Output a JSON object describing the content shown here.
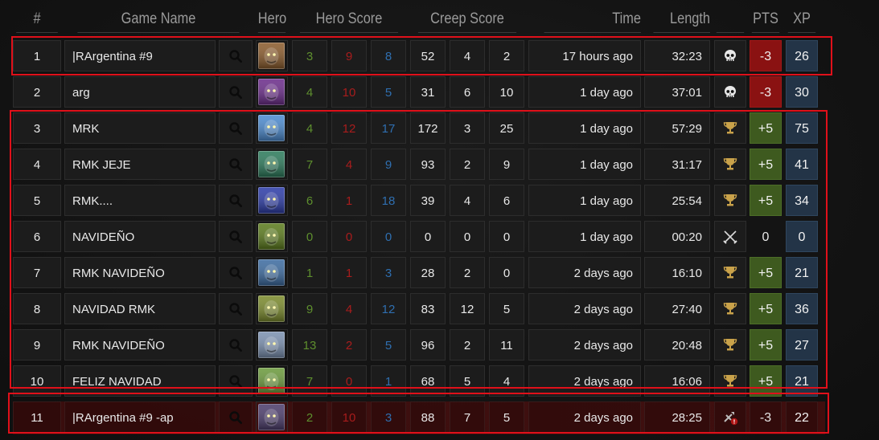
{
  "headers": {
    "rank": "#",
    "game_name": "Game Name",
    "hero": "Hero",
    "hero_score": "Hero Score",
    "creep_score": "Creep Score",
    "time": "Time",
    "length": "Length",
    "pts": "PTS",
    "xp": "XP"
  },
  "colors": {
    "kills": "#5e8f2e",
    "deaths": "#a81c1c",
    "assists": "#2f6fb0",
    "pts_positive": "#3e5a1f",
    "pts_negative": "#8a1212",
    "xp_bg": "#233447",
    "highlight_box": "#e0101a"
  },
  "rows": [
    {
      "rank": "1",
      "name": "|RArgentina #9",
      "hero": "beast-face-icon",
      "hero_color": "#8a5a2a",
      "k": "3",
      "d": "9",
      "a": "8",
      "c1": "52",
      "c2": "4",
      "c3": "2",
      "time": "17 hours ago",
      "length": "32:23",
      "result": "skull-icon",
      "pts": "-3",
      "pts_type": "neg",
      "xp": "26",
      "row_style": "normal"
    },
    {
      "rank": "2",
      "name": "arg",
      "hero": "purple-beast-icon",
      "hero_color": "#6a2a8a",
      "k": "4",
      "d": "10",
      "a": "5",
      "c1": "31",
      "c2": "6",
      "c3": "10",
      "time": "1 day ago",
      "length": "37:01",
      "result": "skull-icon",
      "pts": "-3",
      "pts_type": "neg",
      "xp": "30",
      "row_style": "normal"
    },
    {
      "rank": "3",
      "name": "MRK",
      "hero": "frost-hero-icon",
      "hero_color": "#4a8ad0",
      "k": "4",
      "d": "12",
      "a": "17",
      "c1": "172",
      "c2": "3",
      "c3": "25",
      "time": "1 day ago",
      "length": "57:29",
      "result": "trophy-icon",
      "pts": "+5",
      "pts_type": "pos",
      "xp": "75",
      "row_style": "normal"
    },
    {
      "rank": "4",
      "name": "RMK JEJE",
      "hero": "green-warden-icon",
      "hero_color": "#2a7a5a",
      "k": "7",
      "d": "4",
      "a": "9",
      "c1": "93",
      "c2": "2",
      "c3": "9",
      "time": "1 day ago",
      "length": "31:17",
      "result": "trophy-icon",
      "pts": "+5",
      "pts_type": "pos",
      "xp": "41",
      "row_style": "normal"
    },
    {
      "rank": "5",
      "name": "RMK....",
      "hero": "blue-naga-icon",
      "hero_color": "#2a3aa8",
      "k": "6",
      "d": "1",
      "a": "18",
      "c1": "39",
      "c2": "4",
      "c3": "6",
      "time": "1 day ago",
      "length": "25:54",
      "result": "trophy-icon",
      "pts": "+5",
      "pts_type": "pos",
      "xp": "34",
      "row_style": "normal"
    },
    {
      "rank": "6",
      "name": "NAVIDEÑO",
      "hero": "goblin-icon",
      "hero_color": "#5a7a1a",
      "k": "0",
      "d": "0",
      "a": "0",
      "c1": "0",
      "c2": "0",
      "c3": "0",
      "time": "1 day ago",
      "length": "00:20",
      "result": "crossed-swords-icon",
      "pts": "0",
      "pts_type": "neu",
      "xp": "0",
      "row_style": "normal"
    },
    {
      "rank": "7",
      "name": "RMK NAVIDEÑO",
      "hero": "blue-troll-icon",
      "hero_color": "#3a6aa0",
      "k": "1",
      "d": "1",
      "a": "3",
      "c1": "28",
      "c2": "2",
      "c3": "0",
      "time": "2 days ago",
      "length": "16:10",
      "result": "trophy-icon",
      "pts": "+5",
      "pts_type": "pos",
      "xp": "21",
      "row_style": "normal"
    },
    {
      "rank": "8",
      "name": "NAVIDAD RMK",
      "hero": "ranger-icon",
      "hero_color": "#7a8a2a",
      "k": "9",
      "d": "4",
      "a": "12",
      "c1": "83",
      "c2": "12",
      "c3": "5",
      "time": "2 days ago",
      "length": "27:40",
      "result": "trophy-icon",
      "pts": "+5",
      "pts_type": "pos",
      "xp": "36",
      "row_style": "normal"
    },
    {
      "rank": "9",
      "name": "RMK NAVIDEÑO",
      "hero": "bearded-wizard-icon",
      "hero_color": "#7a90b0",
      "k": "13",
      "d": "2",
      "a": "5",
      "c1": "96",
      "c2": "2",
      "c3": "11",
      "time": "2 days ago",
      "length": "20:48",
      "result": "trophy-icon",
      "pts": "+5",
      "pts_type": "pos",
      "xp": "27",
      "row_style": "normal"
    },
    {
      "rank": "10",
      "name": "FELIZ NAVIDAD",
      "hero": "ranger-icon",
      "hero_color": "#6a9a3a",
      "k": "7",
      "d": "0",
      "a": "1",
      "c1": "68",
      "c2": "5",
      "c3": "4",
      "time": "2 days ago",
      "length": "16:06",
      "result": "trophy-icon",
      "pts": "+5",
      "pts_type": "pos",
      "xp": "21",
      "row_style": "normal"
    },
    {
      "rank": "11",
      "name": "|RArgentina #9 -ap",
      "hero": "dark-ranger-icon",
      "hero_color": "#4a3a6a",
      "k": "2",
      "d": "10",
      "a": "3",
      "c1": "88",
      "c2": "7",
      "c3": "5",
      "time": "2 days ago",
      "length": "28:25",
      "result": "leaver-icon",
      "pts": "-3",
      "pts_type": "neu",
      "xp": "22",
      "row_style": "defeat"
    }
  ]
}
